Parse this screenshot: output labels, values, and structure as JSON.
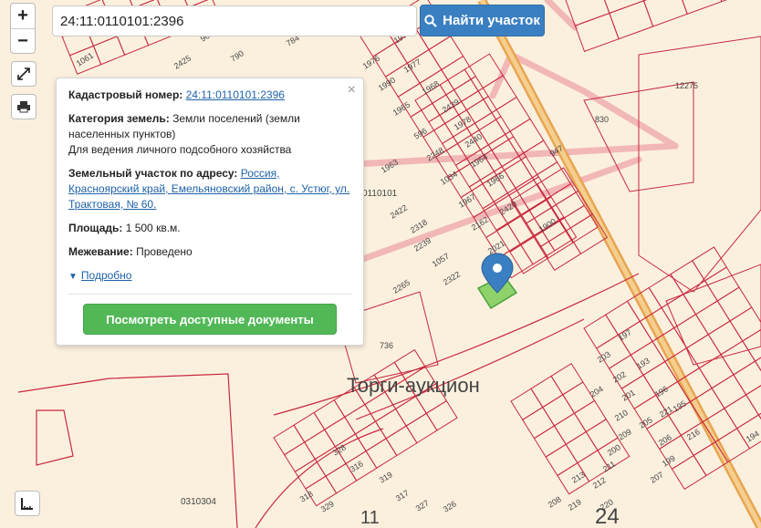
{
  "search": {
    "value": "24:11:0110101:2396",
    "button_label": "Найти участок"
  },
  "controls": {
    "zoom_in": "+",
    "zoom_out": "−"
  },
  "popup": {
    "close": "×",
    "cadastral_label": "Кадастровый номер:",
    "cadastral_value": "24:11:0110101:2396",
    "category_label": "Категория земель:",
    "category_value": "Земли поселений (земли населенных пунктов)",
    "purpose": "Для ведения личного подсобного хозяйства",
    "address_label": "Земельный участок по адресу:",
    "address_value": "Россия, Красноярский край, Емельяновский район, с. Устюг, ул. Трактовая, № 60.",
    "area_label": "Площадь:",
    "area_value": "1 500 кв.м.",
    "survey_label": "Межевание:",
    "survey_value": "Проведено",
    "more_label": "Подробно",
    "docs_button": "Посмотреть доступные документы"
  },
  "map": {
    "parcel_labels": [
      "1975",
      "1976",
      "1977",
      "1990",
      "1965",
      "1968",
      "2439",
      "1978",
      "596",
      "2440",
      "2248",
      "1963",
      "1964",
      "1034",
      "1966",
      "1967",
      "2420",
      "2162",
      "1900",
      "2021",
      "2422",
      "2318",
      "2239",
      "1057",
      "2322",
      "2265",
      "736",
      "830",
      "12275",
      "947",
      "1061",
      "2425",
      "784",
      "790",
      "960",
      "0110101",
      "0310304",
      "328",
      "316",
      "319",
      "317",
      "318",
      "329",
      "327",
      "326",
      "197",
      "193",
      "203",
      "202",
      "201",
      "204",
      "210",
      "209",
      "205",
      "200",
      "206",
      "211",
      "199",
      "212",
      "213",
      "207",
      "208",
      "219",
      "220",
      "221",
      "216",
      "196",
      "195",
      "194",
      "407"
    ],
    "block_labels": [
      "11",
      "24"
    ],
    "watermark": "Торги-аукцион"
  }
}
